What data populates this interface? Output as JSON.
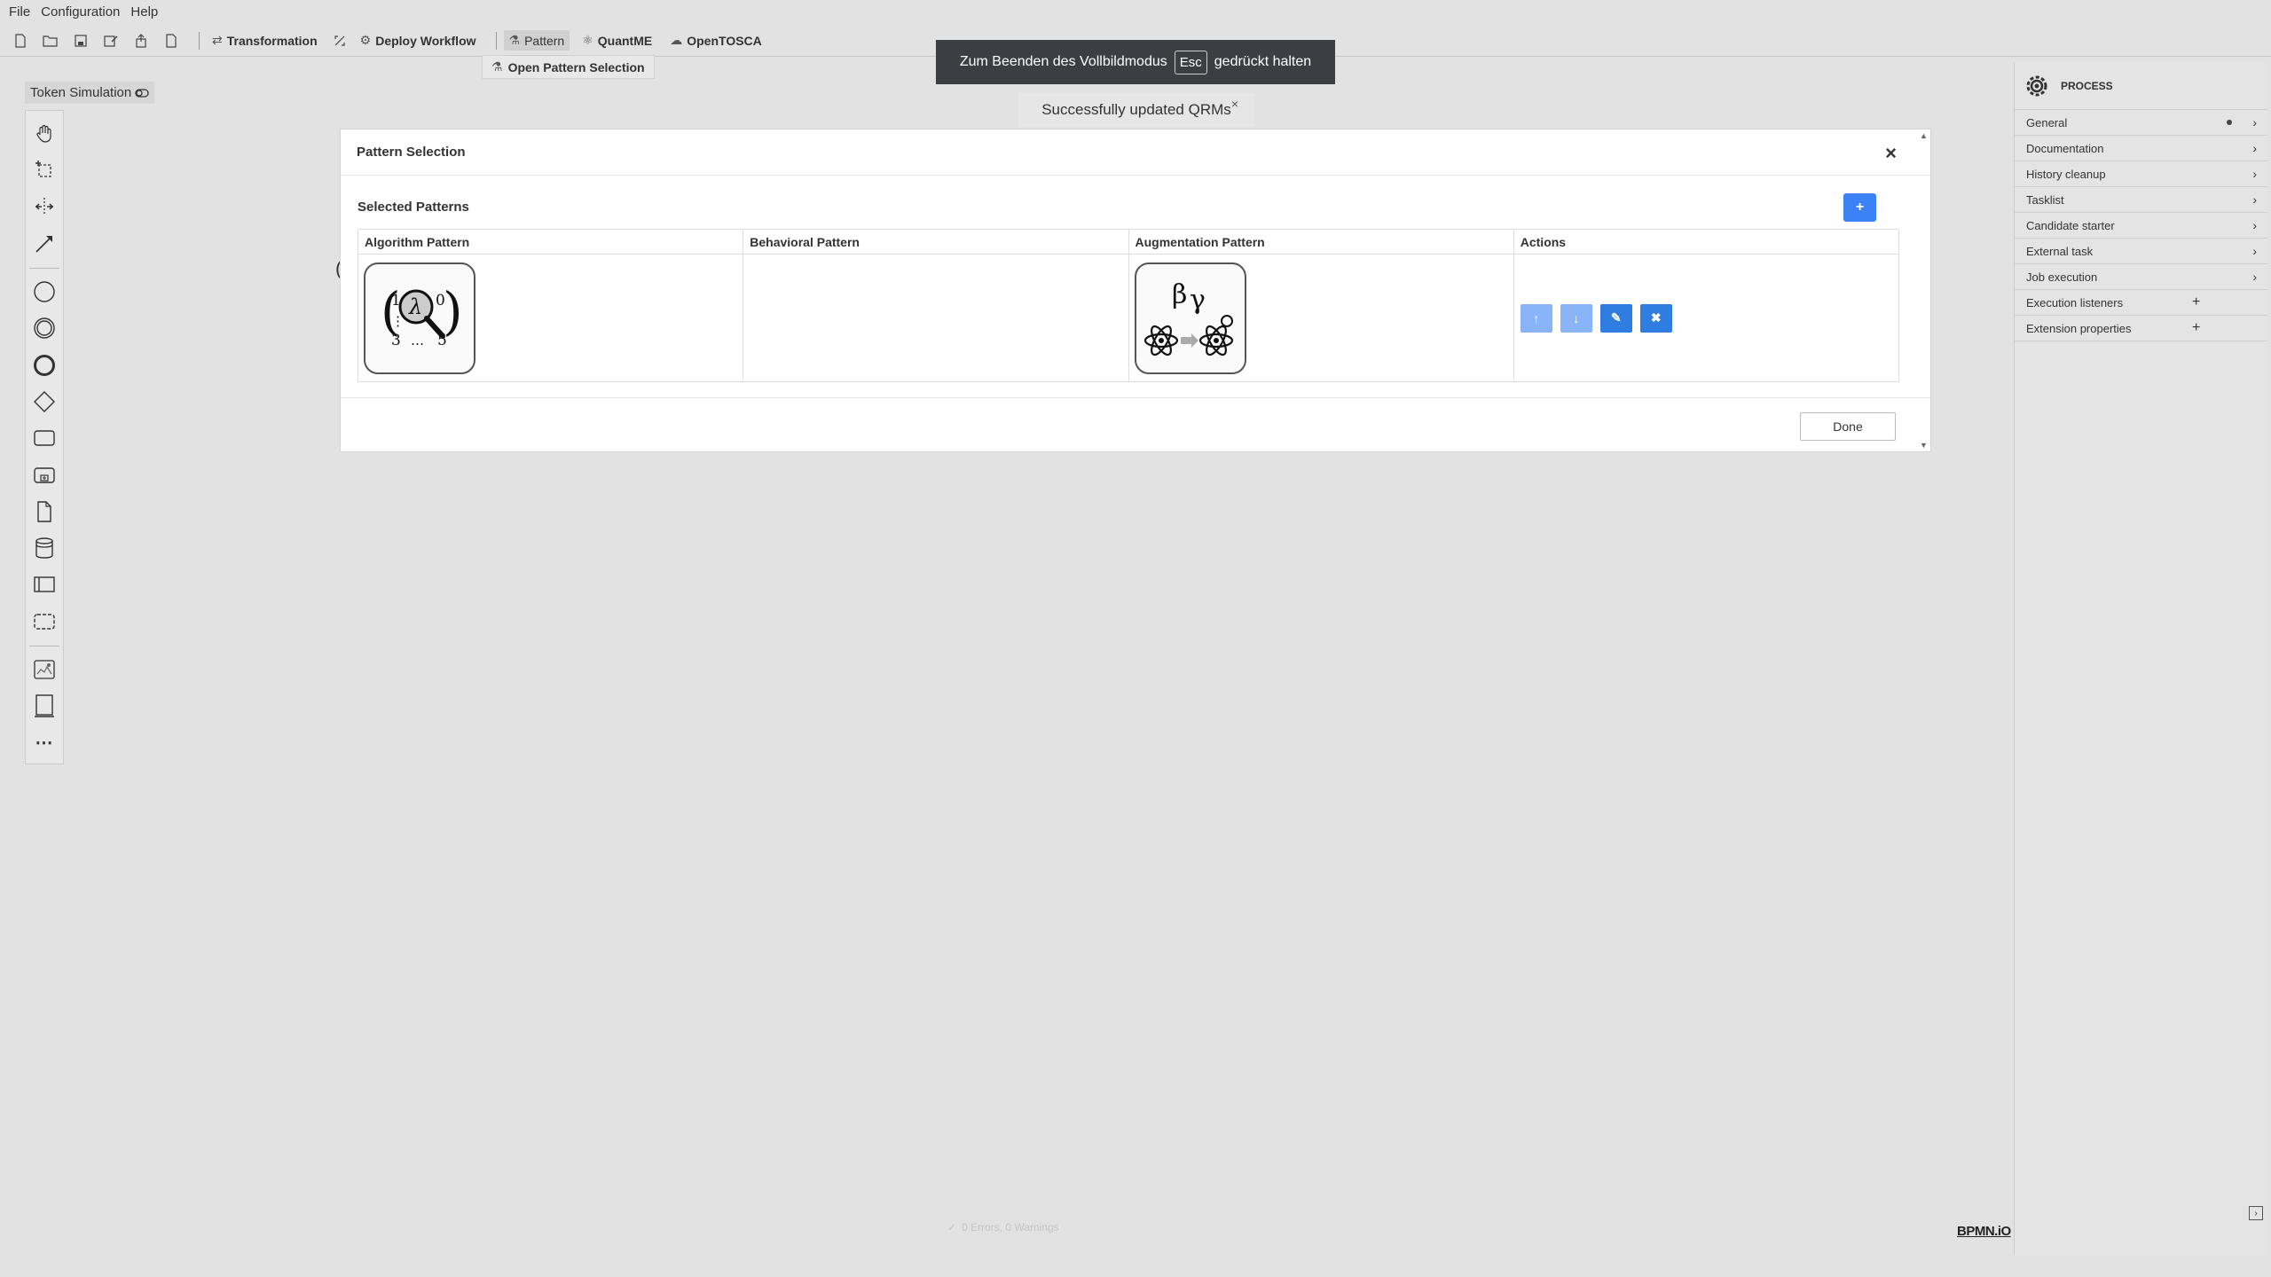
{
  "menubar": {
    "items": [
      "File",
      "Configuration",
      "Help"
    ]
  },
  "toolbar": {
    "transformation": "Transformation",
    "deploy": "Deploy Workflow",
    "pattern": "Pattern",
    "quantme": "QuantME",
    "opentosca": "OpenTOSCA",
    "dropdown_item": "Open Pattern Selection"
  },
  "fullscreen_hint": {
    "before": "Zum Beenden des Vollbildmodus",
    "key": "Esc",
    "after": "gedrückt halten"
  },
  "notification": {
    "text": "Successfully updated QRMs",
    "close": "×"
  },
  "token_simulation": {
    "label": "Token Simulation"
  },
  "modal": {
    "title": "Pattern Selection",
    "close": "×",
    "selected_title": "Selected Patterns",
    "add_label": "+",
    "columns": [
      "Algorithm Pattern",
      "Behavioral Pattern",
      "Augmentation Pattern",
      "Actions"
    ],
    "actions": {
      "up": "↑",
      "down": "↓",
      "edit": "✎",
      "delete": "✖"
    },
    "done_label": "Done"
  },
  "properties": {
    "header": "PROCESS",
    "groups": [
      {
        "label": "General"
      },
      {
        "label": "Documentation"
      },
      {
        "label": "History cleanup"
      },
      {
        "label": "Tasklist"
      },
      {
        "label": "Candidate starter"
      },
      {
        "label": "External task"
      },
      {
        "label": "Job execution"
      },
      {
        "label": "Execution listeners"
      },
      {
        "label": "Extension properties"
      }
    ]
  },
  "status": {
    "text": "0 Errors, 0 Warnings"
  },
  "logo": "BPMN.iO",
  "colors": {
    "primary": "#2f7de1",
    "primary_light": "#8ab4f8",
    "add_button": "#3b82f6"
  }
}
